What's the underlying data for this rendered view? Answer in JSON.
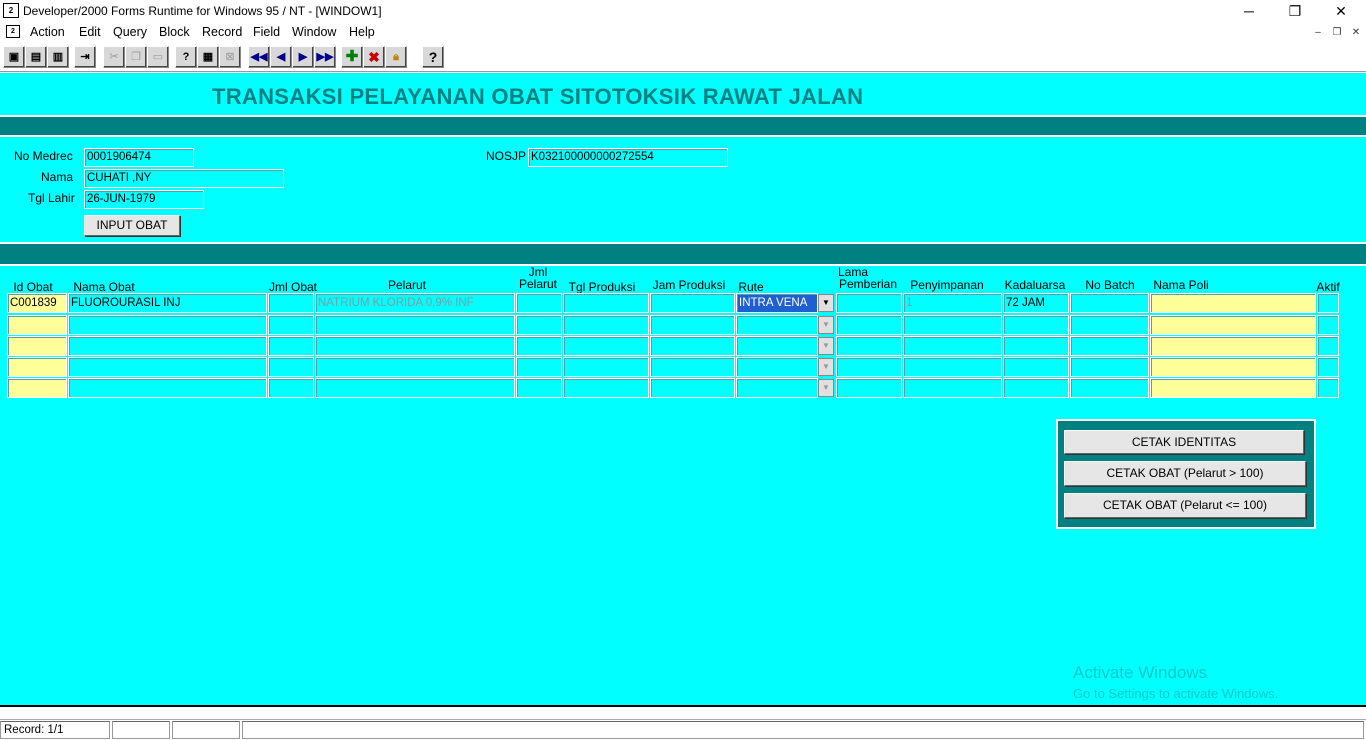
{
  "window": {
    "title": "Developer/2000 Forms Runtime for Windows 95 / NT - [WINDOW1]",
    "app_icon": "forms-app-icon",
    "minimize": "─",
    "restore": "❐",
    "close": "✕"
  },
  "menu": {
    "items": [
      "Action",
      "Edit",
      "Query",
      "Block",
      "Record",
      "Field",
      "Window",
      "Help"
    ],
    "mdi_min": "–",
    "mdi_restore": "❐",
    "mdi_close": "✕"
  },
  "toolbar": {
    "buttons": [
      "save-icon",
      "print-icon",
      "print-setup-icon",
      "exit-icon",
      "cut-icon",
      "copy-icon",
      "paste-icon",
      "enter-query-icon",
      "execute-query-icon",
      "cancel-query-icon",
      "first-record-icon",
      "previous-record-icon",
      "next-record-icon",
      "last-record-icon",
      "insert-record-icon",
      "delete-record-icon",
      "lock-record-icon",
      "help-icon"
    ]
  },
  "form": {
    "title": "TRANSAKSI PELAYANAN OBAT SITOTOKSIK RAWAT JALAN",
    "no_medrec_label": "No Medrec",
    "no_medrec": "0001906474",
    "nama_label": "Nama",
    "nama": "CUHATI ,NY",
    "tgl_lahir_label": "Tgl Lahir",
    "tgl_lahir": "26-JUN-1979",
    "nosjp_label": "NOSJP",
    "nosjp": "K032100000000272554",
    "input_obat_button": "INPUT OBAT"
  },
  "grid": {
    "headers": {
      "id_obat": "Id Obat",
      "nama_obat": "Nama Obat",
      "jml_obat": "Jml Obat",
      "pelarut": "Pelarut",
      "jml_pelarut_1": "Jml",
      "jml_pelarut_2": "Pelarut",
      "tgl_produksi": "Tgl Produksi",
      "jam_produksi": "Jam Produksi",
      "rute": "Rute",
      "lama_pemberian_1": "Lama",
      "lama_pemberian_2": "Pemberian",
      "penyimpanan": "Penyimpanan",
      "kadaluarsa": "Kadaluarsa",
      "no_batch": "No Batch",
      "nama_poli": "Nama Poli",
      "aktif": "Aktif"
    },
    "row1": {
      "id_obat": "C001839",
      "nama_obat": "FLUOROURASIL INJ",
      "jml_obat": "",
      "pelarut": "NATRIUM KLORIDA 0,9% INF",
      "jml_pelarut": "",
      "tgl_produksi": "",
      "jam_produksi": "",
      "rute": "INTRA VENA",
      "lama_pemberian": "",
      "penyimpanan": "1",
      "kadaluarsa": "72 JAM",
      "no_batch": "",
      "nama_poli": "",
      "aktif": ""
    },
    "empty_rows": 4
  },
  "print_panel": {
    "cetak_identitas": "CETAK IDENTITAS",
    "cetak_obat_gt": "CETAK OBAT (Pelarut > 100)",
    "cetak_obat_le": "CETAK OBAT (Pelarut <= 100)"
  },
  "watermark": {
    "line1": "Activate Windows",
    "line2": "Go to Settings to activate Windows."
  },
  "status": {
    "record": "Record: 1/1"
  },
  "colors": {
    "canvas": "#00ffff",
    "band": "#008080",
    "title_text": "#008080",
    "required_field": "#ffff99"
  }
}
